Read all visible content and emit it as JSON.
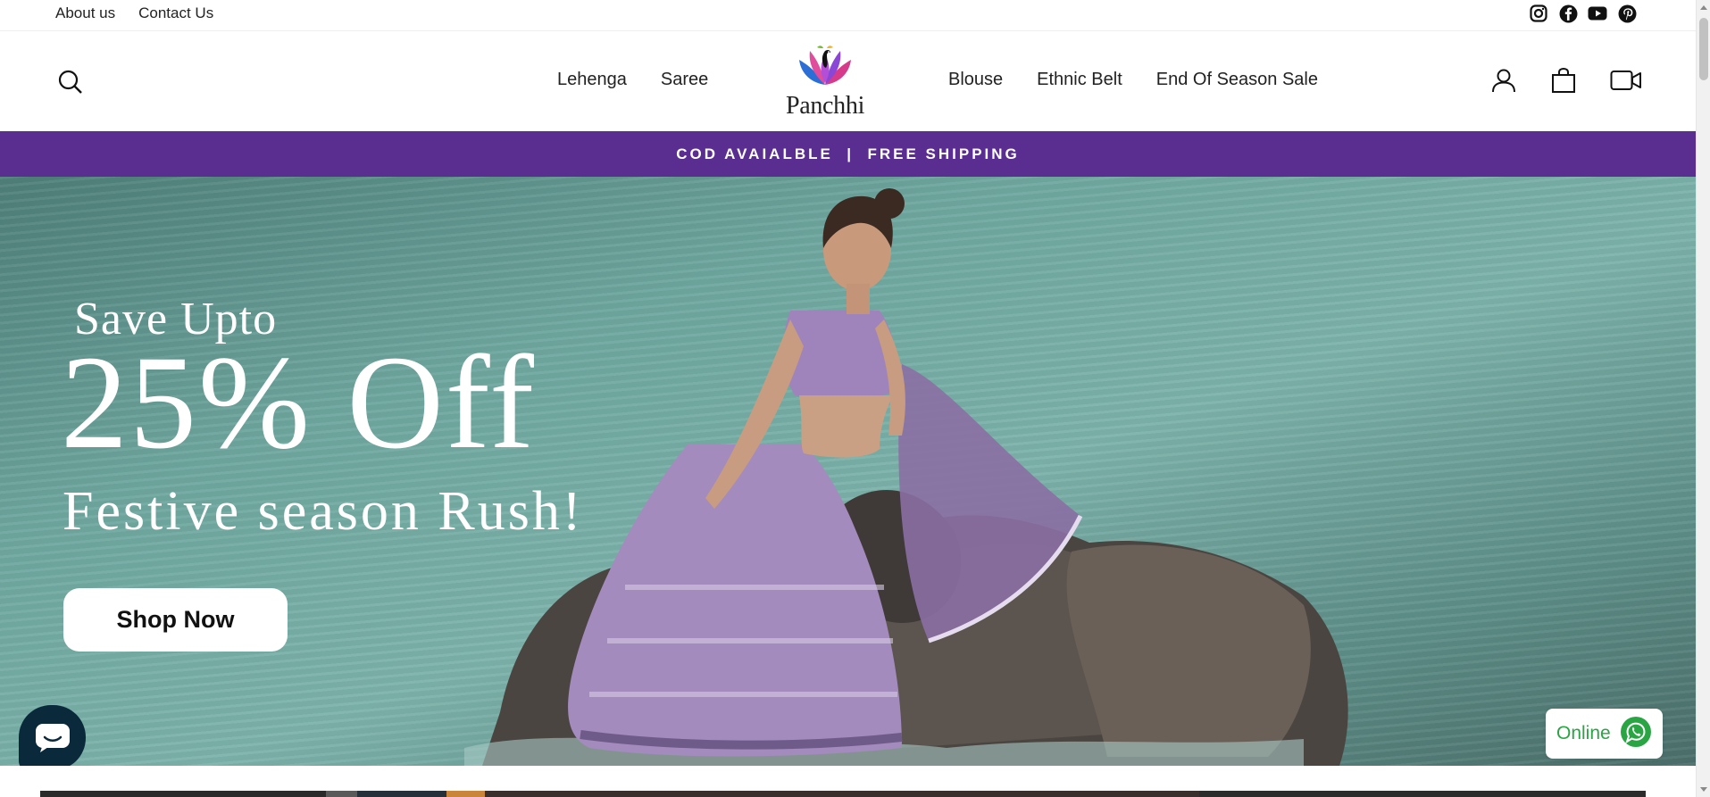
{
  "utility": {
    "about_label": "About us",
    "contact_label": "Contact Us",
    "social": [
      "instagram-icon",
      "facebook-icon",
      "youtube-icon",
      "pinterest-icon"
    ]
  },
  "header": {
    "logo_text": "Panchhi",
    "nav_left": [
      "Lehenga",
      "Saree"
    ],
    "nav_right": [
      "Blouse",
      "Ethnic Belt",
      "End Of Season Sale"
    ],
    "icons": [
      "search-icon",
      "account-icon",
      "cart-icon",
      "video-icon"
    ]
  },
  "announcement": {
    "text": "COD AVAIALBLE  |  FREE SHIPPING",
    "bg_color": "#5a2d91"
  },
  "hero": {
    "line1": "Save Upto",
    "line2": "25% Off",
    "line3": "Festive season Rush!",
    "button_label": "Shop Now"
  },
  "widgets": {
    "chat_icon": "chat-icon",
    "whatsapp_label": "Online",
    "whatsapp_color": "#2aa544"
  }
}
